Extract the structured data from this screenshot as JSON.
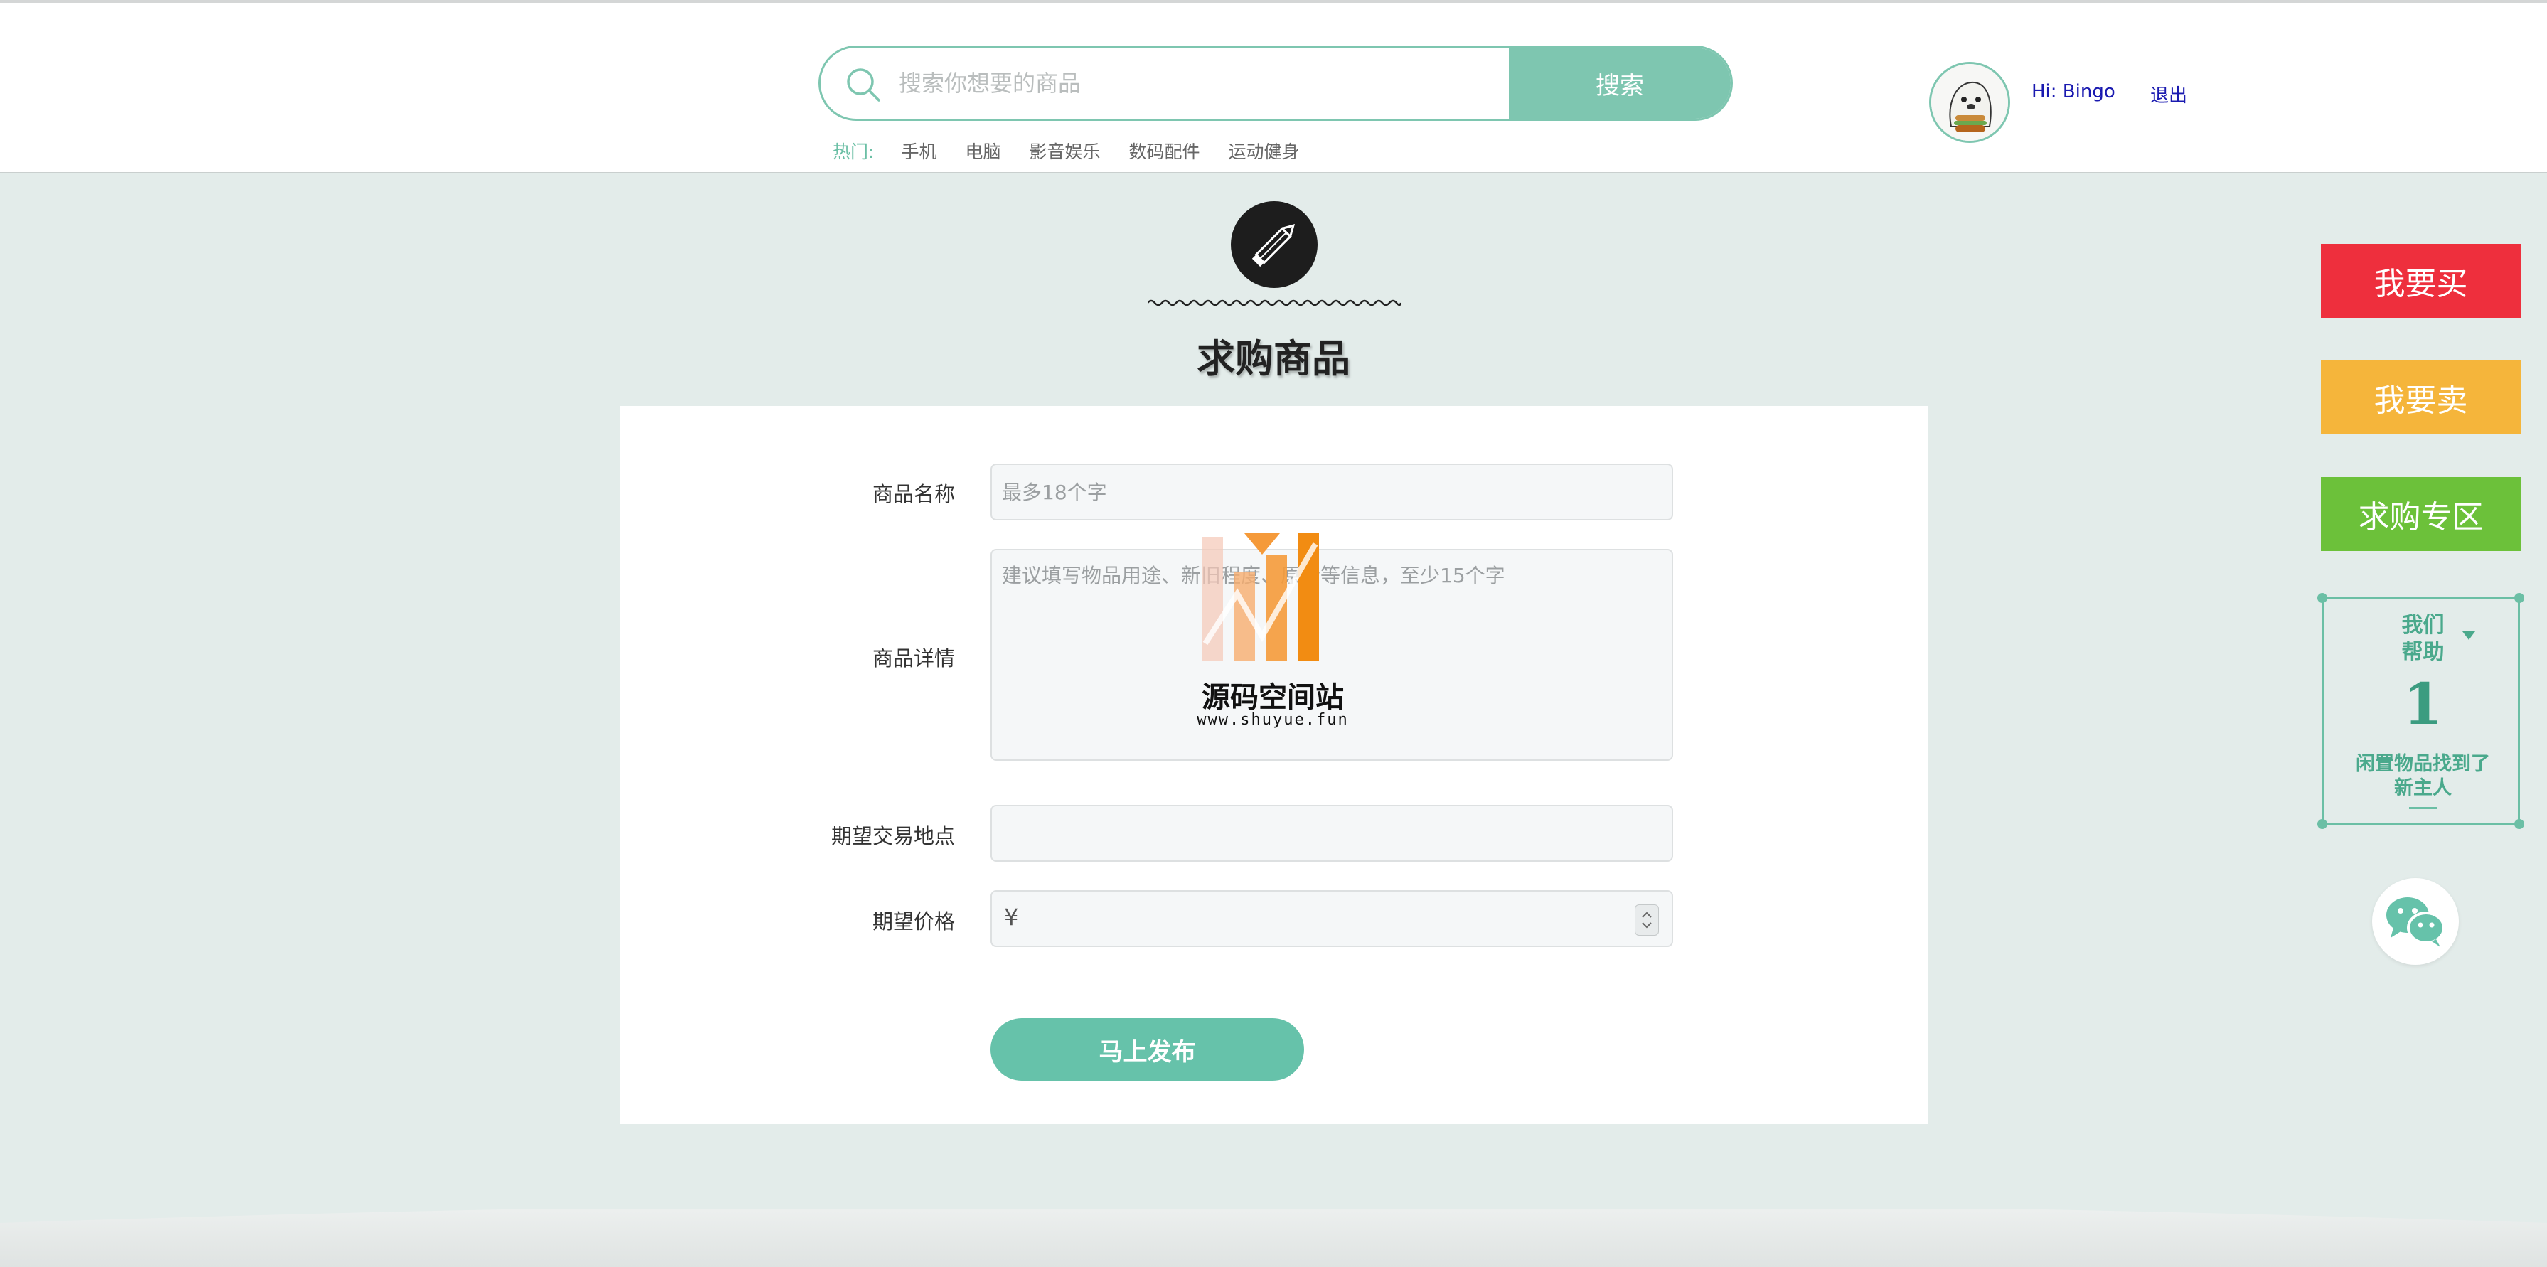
{
  "search": {
    "placeholder": "搜索你想要的商品",
    "button_label": "搜索"
  },
  "hot": {
    "label": "热门:",
    "items": [
      "手机",
      "电脑",
      "影音娱乐",
      "数码配件",
      "运动健身"
    ]
  },
  "user": {
    "greeting": "Hi:  Bingo",
    "logout_label": "退出"
  },
  "page": {
    "title": "求购商品"
  },
  "form": {
    "name_label": "商品名称",
    "name_placeholder": "最多18个字",
    "detail_label": "商品详情",
    "detail_placeholder": "建议填写物品用途、新旧程度、原价等信息，至少15个字",
    "location_label": "期望交易地点",
    "location_value": "",
    "price_label": "期望价格",
    "price_prefix": "¥",
    "price_value": "",
    "submit_label": "马上发布"
  },
  "watermark": {
    "title": "源码空间站",
    "url": "www.shuyue.fun"
  },
  "sidebar": {
    "buy_label": "我要买",
    "sell_label": "我要卖",
    "wanted_label": "求购专区",
    "buy_color": "#ee2f3d",
    "sell_color": "#f5b53b",
    "wanted_color": "#6cc13a",
    "helped_heading_line1": "我们",
    "helped_heading_line2": "帮助",
    "helped_count": "1",
    "helped_text_line1": "闲置物品找到了",
    "helped_text_line2": "新主人"
  },
  "colors": {
    "accent": "#7ec6b0",
    "page_background": "#e3ecea"
  }
}
